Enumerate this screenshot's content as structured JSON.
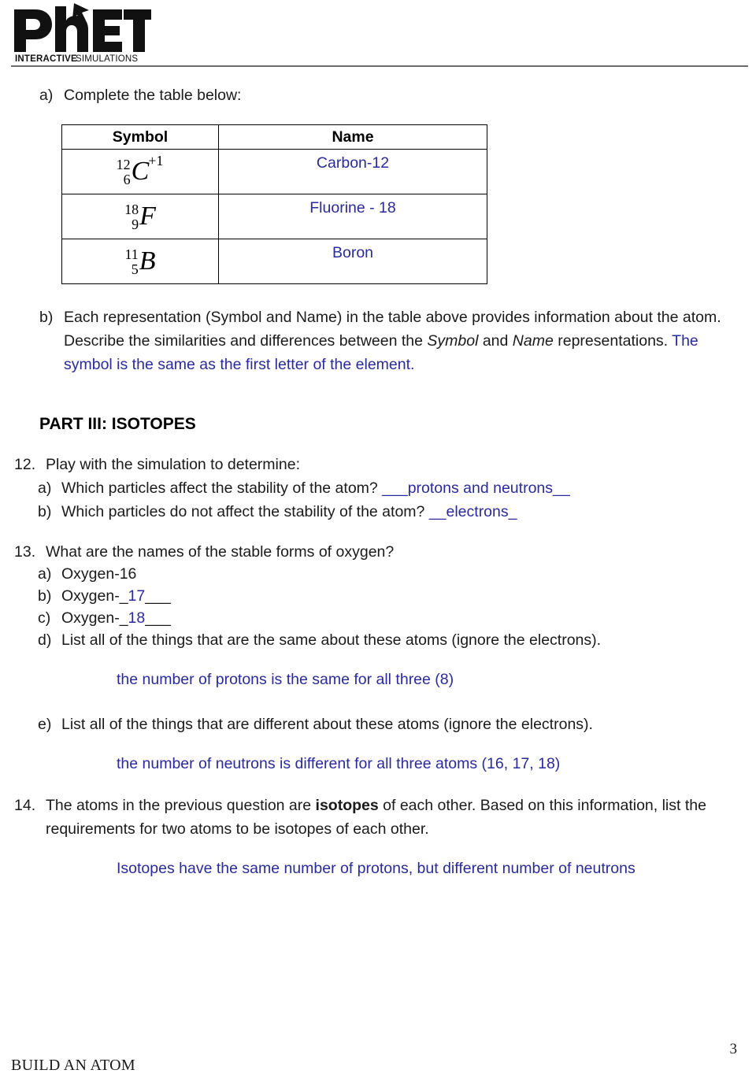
{
  "header": {
    "logo_name": "phet-interactive-simulations-logo",
    "logo_primary_text": "PhET",
    "logo_sub_bold": "INTERACTIVE",
    "logo_sub_regular": "SIMULATIONS"
  },
  "section_a": {
    "marker": "a)",
    "text": "Complete the table below:"
  },
  "table": {
    "headers": [
      "Symbol",
      "Name"
    ],
    "rows": [
      {
        "symbol": {
          "mass": "12",
          "atomic": "6",
          "element": "C",
          "charge": "+1"
        },
        "name": "Carbon-12"
      },
      {
        "symbol": {
          "mass": "18",
          "atomic": "9",
          "element": "F",
          "charge": ""
        },
        "name": "Fluorine - 18"
      },
      {
        "symbol": {
          "mass": "11",
          "atomic": "5",
          "element": "B",
          "charge": ""
        },
        "name": "Boron"
      }
    ]
  },
  "section_b": {
    "marker": "b)",
    "text_1": "Each representation (Symbol and Name) in the table above provides information about the atom. Describe the similarities and differences between the ",
    "italic_1": "Symbol",
    "text_2": " and ",
    "italic_2": "Name",
    "text_3": " representations. ",
    "answer": "The symbol is the same as the first letter of the element."
  },
  "part3": {
    "heading": "PART III: ISOTOPES"
  },
  "item12": {
    "number": "12.",
    "stem": "Play with the simulation to determine:",
    "sub": [
      {
        "letter": "a)",
        "question": "Which particles affect the stability of the atom?",
        "answer": "___protons and neutrons__"
      },
      {
        "letter": "b)",
        "question": "Which particles do not affect the stability of the atom?",
        "answer": "__electrons_"
      }
    ]
  },
  "item13": {
    "number": "13.",
    "stem": "What are the names of the stable forms of oxygen?",
    "sub_a": {
      "letter": "a)",
      "text": "Oxygen-16"
    },
    "sub_b": {
      "letter": "b)",
      "prefix": "Oxygen-_",
      "answer": "17",
      "suffix": "___"
    },
    "sub_c": {
      "letter": "c)",
      "prefix": "Oxygen-_",
      "answer": "18",
      "suffix": "___"
    },
    "sub_d": {
      "letter": "d)",
      "text": "List all of the things that are the same about these atoms (ignore the electrons).",
      "answer": "the number of protons is the same for all three (8)"
    },
    "sub_e": {
      "letter": "e)",
      "text": "List all of the things that are different about these atoms (ignore the electrons).",
      "answer": "the number of neutrons is different for all three atoms (16, 17, 18)"
    }
  },
  "item14": {
    "number": "14.",
    "text_1": "The atoms in the previous question are ",
    "bold_1": "isotopes",
    "text_2": " of each other.  Based on this information, list the requirements for two atoms to be isotopes of each other.",
    "answer": "Isotopes have the same number of protons, but different number of neutrons"
  },
  "footer": {
    "page_number": "3",
    "title": "BUILD AN ATOM"
  },
  "colors": {
    "answer_blue": "#2a2a9c",
    "text_black": "#1a1a1a",
    "rule_gray": "#6b6b6b"
  }
}
